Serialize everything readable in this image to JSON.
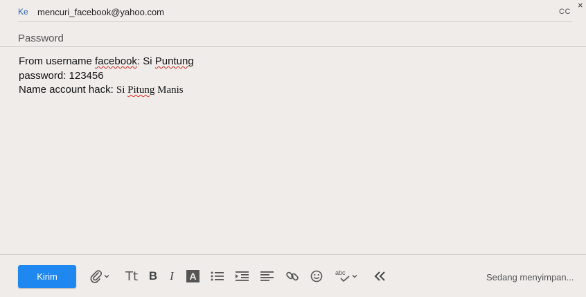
{
  "header": {
    "to_label": "Ke",
    "to_value": "mencuri_facebook@yahoo.com",
    "cc_label": "CC",
    "close_glyph": "×"
  },
  "subject": "Password",
  "body": {
    "line1_prefix": "From username ",
    "line1_word1": "facebook",
    "line1_mid": ": Si ",
    "line1_word2": "Puntung",
    "line2": "password: 123456",
    "line3_prefix": "Name account hack: ",
    "line3_si": "Si ",
    "line3_word": "Pitung",
    "line3_end": " Manis"
  },
  "toolbar": {
    "send_label": "Kirim",
    "format_glyph": "Tt",
    "bold_glyph": "B",
    "italic_glyph": "I",
    "textcolor_glyph": "A",
    "spell_glyph": "abc",
    "status": "Sedang menyimpan..."
  },
  "colors": {
    "background": "#efecea",
    "send_button": "#1e88f0",
    "to_label": "#2b5fb4"
  }
}
